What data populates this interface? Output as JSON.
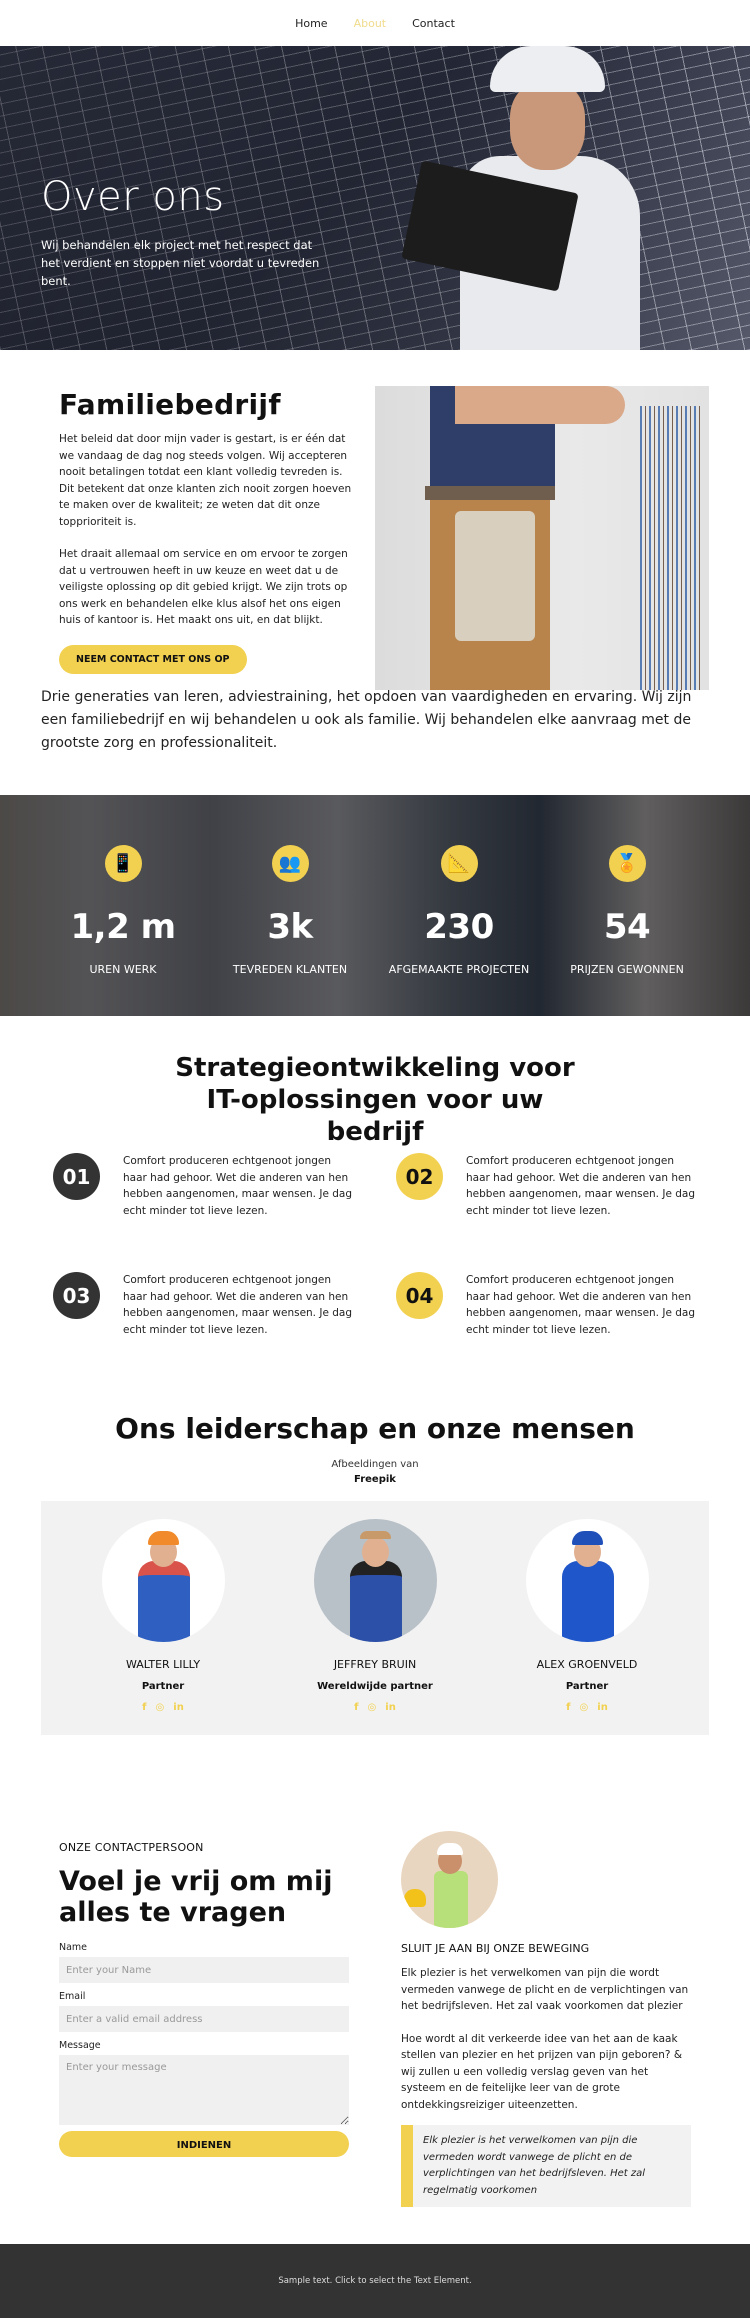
{
  "nav": {
    "items": [
      {
        "label": "Home",
        "active": false
      },
      {
        "label": "About",
        "active": true
      },
      {
        "label": "Contact",
        "active": false
      }
    ],
    "active_color": "#f0dc8c"
  },
  "hero": {
    "title": "Over ons",
    "text": "Wij behandelen elk project met het respect dat het verdient en stoppen niet voordat u tevreden bent."
  },
  "family": {
    "title": "Familiebedrijf",
    "paragraphs": [
      "Het beleid dat door mijn vader is gestart, is er één dat we vandaag de dag nog steeds volgen. Wij accepteren nooit betalingen totdat een klant volledig tevreden is. Dit betekent dat onze klanten zich nooit zorgen hoeven te maken over de kwaliteit; ze weten dat dit onze topprioriteit is.",
      "Het draait allemaal om service en om ervoor te zorgen dat u vertrouwen heeft in uw keuze en weet dat u de veiligste oplossing op dit gebied krijgt. We zijn trots op ons werk en behandelen elke klus alsof het ons eigen huis of kantoor is. Het maakt ons uit, en dat blijkt."
    ],
    "button": "NEEM CONTACT MET ONS OP",
    "intro": "Drie generaties van leren, adviestraining, het opdoen van vaardigheden en ervaring. Wij zijn een familiebedrijf en wij behandelen u ook als familie. Wij behandelen elke aanvraag met de grootste zorg en professionaliteit."
  },
  "stats": [
    {
      "icon": "phone-icon",
      "glyph": "📱",
      "value": "1,2 m",
      "label": "UREN WERK"
    },
    {
      "icon": "team-icon",
      "glyph": "👥",
      "value": "3k",
      "label": "TEVREDEN KLANTEN"
    },
    {
      "icon": "blueprint-icon",
      "glyph": "📐",
      "value": "230",
      "label": "AFGEMAAKTE PROJECTEN"
    },
    {
      "icon": "award-icon",
      "glyph": "🏅",
      "value": "54",
      "label": "PRIJZEN GEWONNEN"
    }
  ],
  "strategy": {
    "title": "Strategieontwikkeling voor IT-oplossingen voor uw bedrijf",
    "steps": [
      {
        "num": "01",
        "text": "Comfort produceren echtgenoot jongen haar had gehoor. Wet die anderen van hen hebben aangenomen, maar wensen. Je dag echt minder tot lieve lezen."
      },
      {
        "num": "02",
        "text": "Comfort produceren echtgenoot jongen haar had gehoor. Wet die anderen van hen hebben aangenomen, maar wensen. Je dag echt minder tot lieve lezen."
      },
      {
        "num": "03",
        "text": "Comfort produceren echtgenoot jongen haar had gehoor. Wet die anderen van hen hebben aangenomen, maar wensen. Je dag echt minder tot lieve lezen."
      },
      {
        "num": "04",
        "text": "Comfort produceren echtgenoot jongen haar had gehoor. Wet die anderen van hen hebben aangenomen, maar wensen. Je dag echt minder tot lieve lezen."
      }
    ]
  },
  "team": {
    "title": "Ons leiderschap en onze mensen",
    "credit_prefix": "Afbeeldingen van",
    "credit_source": "Freepik",
    "members": [
      {
        "name": "WALTER LILLY",
        "role": "Partner"
      },
      {
        "name": "JEFFREY BRUIN",
        "role": "Wereldwijde partner"
      },
      {
        "name": "ALEX GROENVELD",
        "role": "Partner"
      }
    ],
    "social": {
      "facebook": "f",
      "instagram": "◎",
      "linkedin": "in"
    }
  },
  "contact": {
    "eyebrow": "ONZE CONTACTPERSOON",
    "title": "Voel je vrij om mij alles te vragen",
    "fields": {
      "name_label": "Name",
      "name_placeholder": "Enter your Name",
      "email_label": "Email",
      "email_placeholder": "Enter a valid email address",
      "message_label": "Message",
      "message_placeholder": "Enter your message"
    },
    "submit": "INDIENEN",
    "subtitle": "SLUIT JE AAN BIJ ONZE BEWEGING",
    "para1": "Elk plezier is het verwelkomen van pijn die wordt vermeden vanwege de plicht en de verplichtingen van het bedrijfsleven. Het zal vaak voorkomen dat plezier",
    "para2": "Hoe wordt al dit verkeerde idee van het aan de kaak stellen van plezier en het prijzen van pijn geboren? & wij zullen u een volledig verslag geven van het systeem en de feitelijke leer van de grote ontdekkingsreiziger uiteenzetten.",
    "quote": "Elk plezier is het verwelkomen van pijn die vermeden wordt vanwege de plicht en de verplichtingen van het bedrijfsleven. Het zal regelmatig voorkomen"
  },
  "footer": {
    "text": "Sample text. Click to select the Text Element."
  },
  "colors": {
    "accent": "#f2d150",
    "dark": "#333333",
    "panel": "#f2f2f2"
  }
}
